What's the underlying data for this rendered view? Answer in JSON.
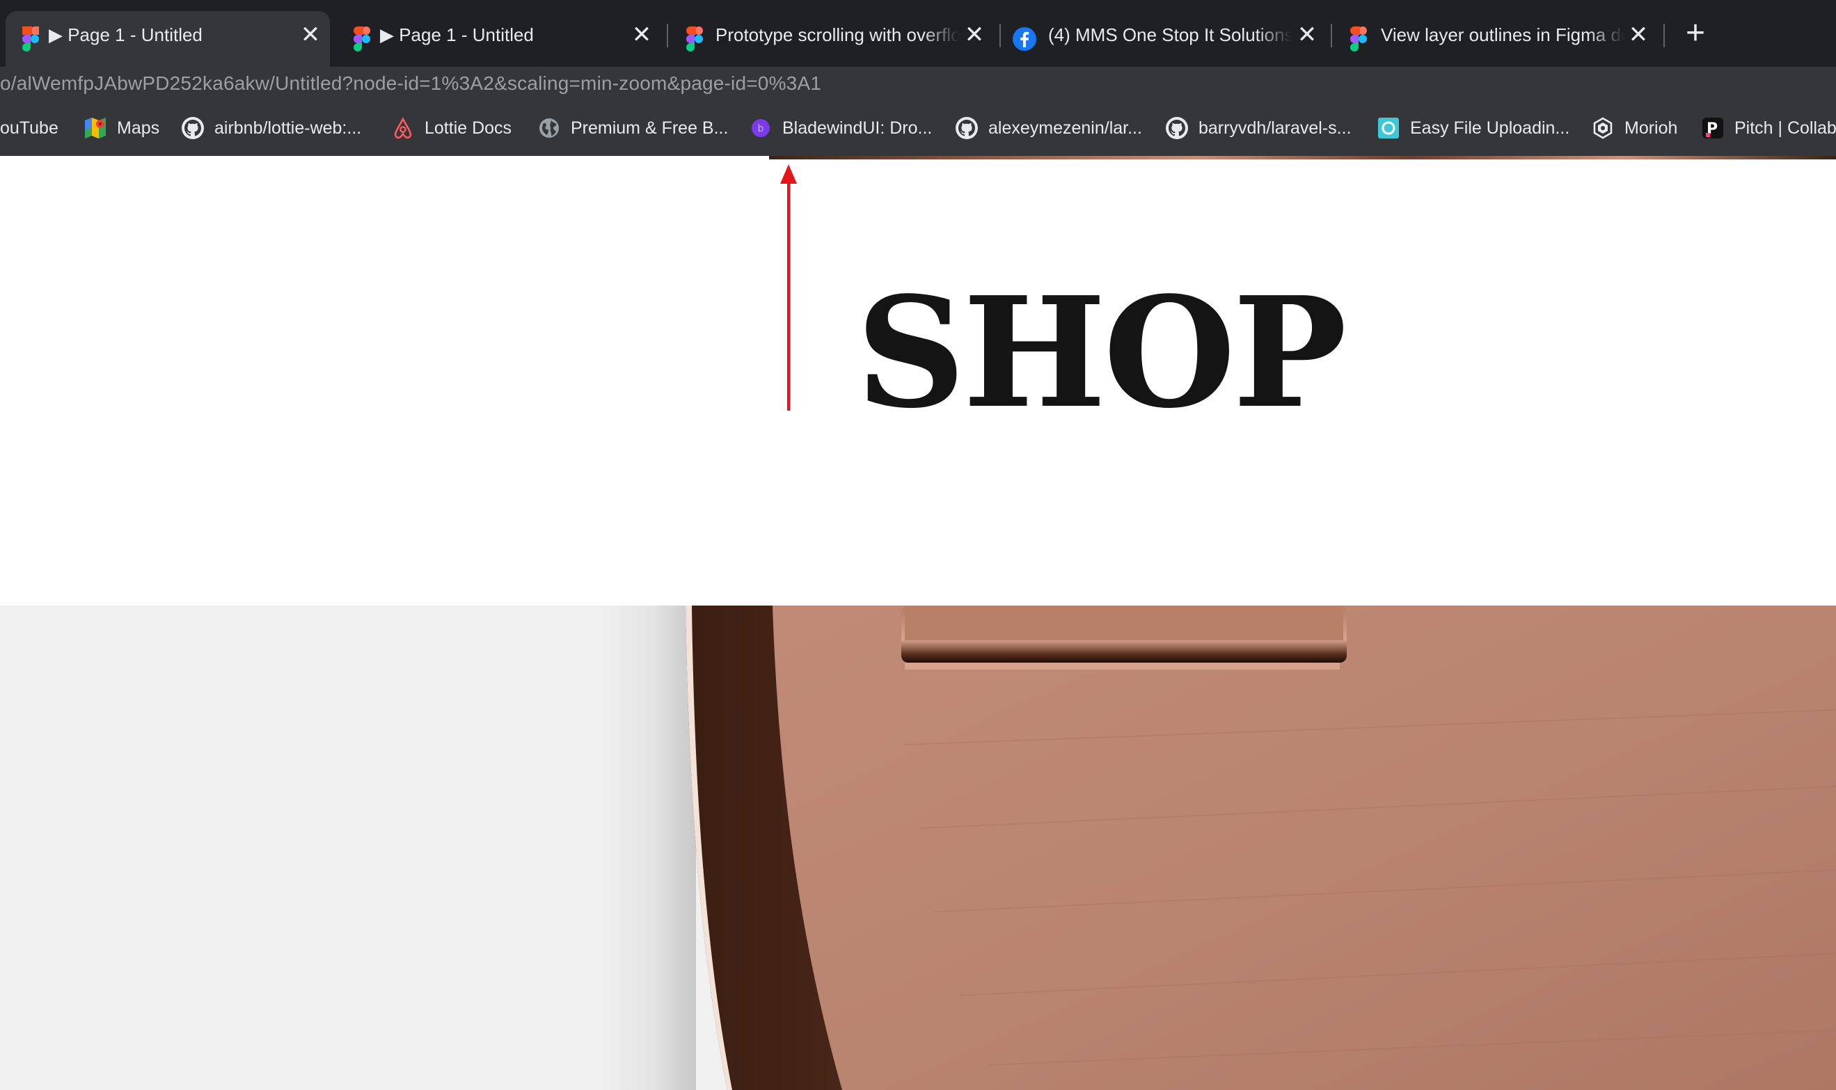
{
  "browser": {
    "tabs": [
      {
        "label": "▶ Page 1 - Untitled",
        "icon": "figma-icon",
        "active": true
      },
      {
        "label": "▶ Page 1 - Untitled",
        "icon": "figma-icon",
        "active": false
      },
      {
        "label": "Prototype scrolling with overflo",
        "icon": "figma-icon",
        "active": false
      },
      {
        "label": "(4) MMS One Stop It Solutions",
        "icon": "facebook-icon",
        "active": false
      },
      {
        "label": "View layer outlines in Figma de",
        "icon": "figma-icon",
        "active": false
      }
    ],
    "new_tab_glyph": "+",
    "close_glyph": "✕",
    "url": "o/alWemfpJAbwPD252ka6akw/Untitled?node-id=1%3A2&scaling=min-zoom&page-id=0%3A1"
  },
  "bookmarks": [
    {
      "label": "ouTube",
      "icon": "youtube-icon"
    },
    {
      "label": "Maps",
      "icon": "maps-icon"
    },
    {
      "label": "airbnb/lottie-web:...",
      "icon": "github-icon"
    },
    {
      "label": "Lottie Docs",
      "icon": "airbnb-icon"
    },
    {
      "label": "Premium & Free B...",
      "icon": "globe-icon"
    },
    {
      "label": "BladewindUI: Dro...",
      "icon": "bladewind-icon"
    },
    {
      "label": "alexeymezenin/lar...",
      "icon": "github-icon"
    },
    {
      "label": "barryvdh/laravel-s...",
      "icon": "github-icon"
    },
    {
      "label": "Easy File Uploadin...",
      "icon": "filepond-icon"
    },
    {
      "label": "Morioh",
      "icon": "morioh-icon"
    },
    {
      "label": "Pitch | Collab",
      "icon": "pitch-icon"
    }
  ],
  "page": {
    "heading": "SHOP",
    "annotation": "red-arrow-up-icon"
  },
  "colors": {
    "tab_strip_bg": "#1f2023",
    "toolbar_bg": "#35363a",
    "text": "#e8eaed",
    "url_text": "#9aa0a6",
    "arrow": "#e3161b",
    "heading": "#141414",
    "copper": "#b98470"
  }
}
